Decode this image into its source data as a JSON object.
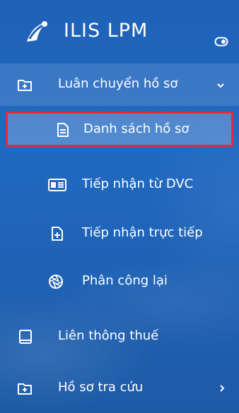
{
  "app": {
    "title": "ILIS LPM"
  },
  "menu": {
    "parent": {
      "label": "Luân chuyển hồ sơ",
      "icon": "folder-plus-icon"
    },
    "children": [
      {
        "label": "Danh sách hồ sơ",
        "icon": "document-icon",
        "selected": true
      },
      {
        "label": "Tiếp nhận từ DVC",
        "icon": "id-card-icon"
      },
      {
        "label": "Tiếp nhận trực tiếp",
        "icon": "file-plus-icon"
      },
      {
        "label": "Phân công lại",
        "icon": "aperture-icon"
      }
    ],
    "items": [
      {
        "label": "Liên thông thuế",
        "icon": "book-icon"
      },
      {
        "label": "Hồ sơ tra cứu",
        "icon": "folder-plus-icon"
      }
    ]
  },
  "colors": {
    "sidebar": "#2069c2",
    "selected_border": "#e8293b"
  }
}
